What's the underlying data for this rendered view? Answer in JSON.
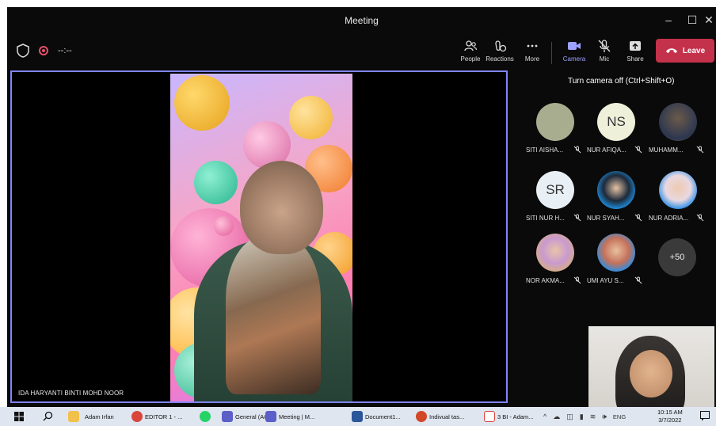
{
  "window": {
    "title": "Meeting"
  },
  "toolbar": {
    "timer": "--:--",
    "people": "People",
    "reactions": "Reactions",
    "more": "More",
    "camera": "Camera",
    "mic": "Mic",
    "share": "Share",
    "leave": "Leave"
  },
  "stage": {
    "speaker_name": "IDA HARYANTI BINTI MOHD NOOR"
  },
  "panel": {
    "tooltip": "Turn camera off (Ctrl+Shift+O)",
    "participants": [
      {
        "name": "SITI AISHA...",
        "initials": ""
      },
      {
        "name": "NUR AFIQA...",
        "initials": "NS"
      },
      {
        "name": "MUHAMM...",
        "initials": ""
      },
      {
        "name": "SITI NUR H...",
        "initials": "SR"
      },
      {
        "name": "NUR SYAH...",
        "initials": ""
      },
      {
        "name": "NUR ADRIA...",
        "initials": ""
      },
      {
        "name": "NOR AKMA...",
        "initials": ""
      },
      {
        "name": "UMI AYU S...",
        "initials": ""
      }
    ],
    "more_count": "+50"
  },
  "taskbar": {
    "items": [
      "Adam Irfan",
      "EDITOR 1 - ...",
      "General (AC...",
      "Meeting | M...",
      "Document1...",
      "Indivual tas...",
      "3 BI - Adam..."
    ],
    "language": "ENG",
    "time": "10:15 AM",
    "date": "3/7/2022"
  },
  "colors": {
    "accent": "#7f85f5",
    "leave": "#c4314b",
    "recording": "#e3506a"
  }
}
